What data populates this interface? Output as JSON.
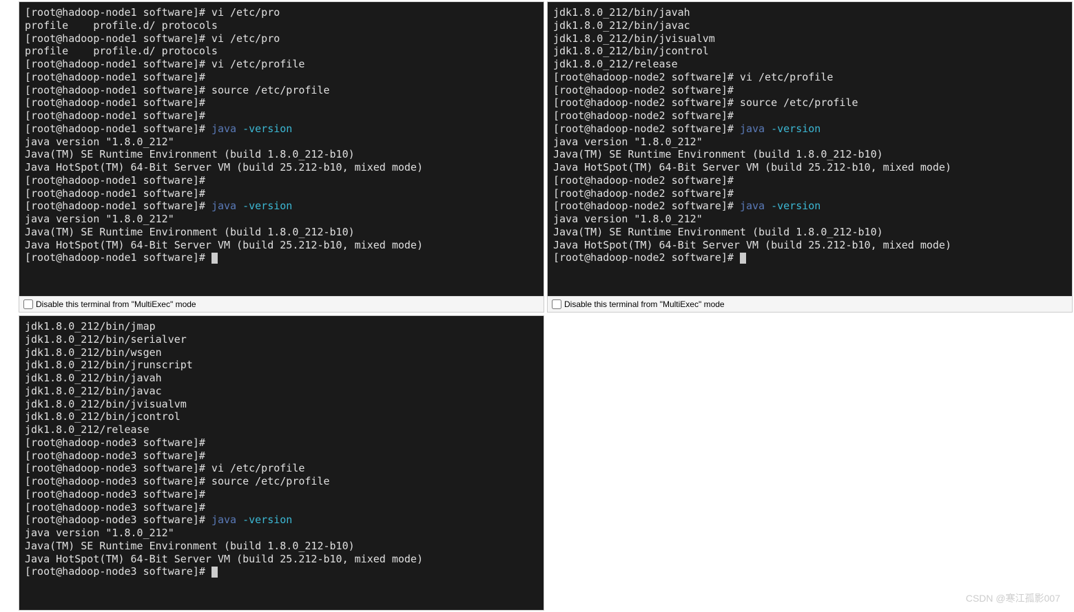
{
  "pane1": {
    "lines": [
      {
        "segments": [
          {
            "t": "[root@hadoop-node1 software]# vi /etc/pro"
          }
        ]
      },
      {
        "segments": [
          {
            "t": "profile    profile.d/ protocols"
          }
        ]
      },
      {
        "segments": [
          {
            "t": "[root@hadoop-node1 software]# vi /etc/pro"
          }
        ]
      },
      {
        "segments": [
          {
            "t": "profile    profile.d/ protocols"
          }
        ]
      },
      {
        "segments": [
          {
            "t": "[root@hadoop-node1 software]# vi /etc/profile"
          }
        ]
      },
      {
        "segments": [
          {
            "t": "[root@hadoop-node1 software]#"
          }
        ]
      },
      {
        "segments": [
          {
            "t": "[root@hadoop-node1 software]# source /etc/profile"
          }
        ]
      },
      {
        "segments": [
          {
            "t": "[root@hadoop-node1 software]#"
          }
        ]
      },
      {
        "segments": [
          {
            "t": "[root@hadoop-node1 software]#"
          }
        ]
      },
      {
        "segments": [
          {
            "t": "[root@hadoop-node1 software]# "
          },
          {
            "t": "java ",
            "cls": "blue"
          },
          {
            "t": "-version",
            "cls": "cyan"
          }
        ]
      },
      {
        "segments": [
          {
            "t": "java version \"1.8.0_212\""
          }
        ]
      },
      {
        "segments": [
          {
            "t": "Java(TM) SE Runtime Environment (build 1.8.0_212-b10)"
          }
        ]
      },
      {
        "segments": [
          {
            "t": "Java HotSpot(TM) 64-Bit Server VM (build 25.212-b10, mixed mode)"
          }
        ]
      },
      {
        "segments": [
          {
            "t": "[root@hadoop-node1 software]#"
          }
        ]
      },
      {
        "segments": [
          {
            "t": "[root@hadoop-node1 software]#"
          }
        ]
      },
      {
        "segments": [
          {
            "t": "[root@hadoop-node1 software]# "
          },
          {
            "t": "java ",
            "cls": "blue"
          },
          {
            "t": "-version",
            "cls": "cyan"
          }
        ]
      },
      {
        "segments": [
          {
            "t": "java version \"1.8.0_212\""
          }
        ]
      },
      {
        "segments": [
          {
            "t": "Java(TM) SE Runtime Environment (build 1.8.0_212-b10)"
          }
        ]
      },
      {
        "segments": [
          {
            "t": "Java HotSpot(TM) 64-Bit Server VM (build 25.212-b10, mixed mode)"
          }
        ]
      },
      {
        "segments": [
          {
            "t": "[root@hadoop-node1 software]# "
          }
        ],
        "cursor": true
      }
    ],
    "footer_label": "Disable this terminal from \"MultiExec\" mode"
  },
  "pane2": {
    "lines": [
      {
        "segments": [
          {
            "t": "jdk1.8.0_212/bin/javah"
          }
        ]
      },
      {
        "segments": [
          {
            "t": "jdk1.8.0_212/bin/javac"
          }
        ]
      },
      {
        "segments": [
          {
            "t": "jdk1.8.0_212/bin/jvisualvm"
          }
        ]
      },
      {
        "segments": [
          {
            "t": "jdk1.8.0_212/bin/jcontrol"
          }
        ]
      },
      {
        "segments": [
          {
            "t": "jdk1.8.0_212/release"
          }
        ]
      },
      {
        "segments": [
          {
            "t": "[root@hadoop-node2 software]# vi /etc/profile"
          }
        ]
      },
      {
        "segments": [
          {
            "t": "[root@hadoop-node2 software]#"
          }
        ]
      },
      {
        "segments": [
          {
            "t": "[root@hadoop-node2 software]# source /etc/profile"
          }
        ]
      },
      {
        "segments": [
          {
            "t": "[root@hadoop-node2 software]#"
          }
        ]
      },
      {
        "segments": [
          {
            "t": "[root@hadoop-node2 software]# "
          },
          {
            "t": "java ",
            "cls": "blue"
          },
          {
            "t": "-version",
            "cls": "cyan"
          }
        ]
      },
      {
        "segments": [
          {
            "t": "java version \"1.8.0_212\""
          }
        ]
      },
      {
        "segments": [
          {
            "t": "Java(TM) SE Runtime Environment (build 1.8.0_212-b10)"
          }
        ]
      },
      {
        "segments": [
          {
            "t": "Java HotSpot(TM) 64-Bit Server VM (build 25.212-b10, mixed mode)"
          }
        ]
      },
      {
        "segments": [
          {
            "t": "[root@hadoop-node2 software]#"
          }
        ]
      },
      {
        "segments": [
          {
            "t": "[root@hadoop-node2 software]#"
          }
        ]
      },
      {
        "segments": [
          {
            "t": "[root@hadoop-node2 software]# "
          },
          {
            "t": "java ",
            "cls": "blue"
          },
          {
            "t": "-version",
            "cls": "cyan"
          }
        ]
      },
      {
        "segments": [
          {
            "t": "java version \"1.8.0_212\""
          }
        ]
      },
      {
        "segments": [
          {
            "t": "Java(TM) SE Runtime Environment (build 1.8.0_212-b10)"
          }
        ]
      },
      {
        "segments": [
          {
            "t": "Java HotSpot(TM) 64-Bit Server VM (build 25.212-b10, mixed mode)"
          }
        ]
      },
      {
        "segments": [
          {
            "t": "[root@hadoop-node2 software]# "
          }
        ],
        "cursor": true
      }
    ],
    "footer_label": "Disable this terminal from \"MultiExec\" mode"
  },
  "pane3": {
    "lines": [
      {
        "segments": [
          {
            "t": "jdk1.8.0_212/bin/jmap"
          }
        ]
      },
      {
        "segments": [
          {
            "t": "jdk1.8.0_212/bin/serialver"
          }
        ]
      },
      {
        "segments": [
          {
            "t": "jdk1.8.0_212/bin/wsgen"
          }
        ]
      },
      {
        "segments": [
          {
            "t": "jdk1.8.0_212/bin/jrunscript"
          }
        ]
      },
      {
        "segments": [
          {
            "t": "jdk1.8.0_212/bin/javah"
          }
        ]
      },
      {
        "segments": [
          {
            "t": "jdk1.8.0_212/bin/javac"
          }
        ]
      },
      {
        "segments": [
          {
            "t": "jdk1.8.0_212/bin/jvisualvm"
          }
        ]
      },
      {
        "segments": [
          {
            "t": "jdk1.8.0_212/bin/jcontrol"
          }
        ]
      },
      {
        "segments": [
          {
            "t": "jdk1.8.0_212/release"
          }
        ]
      },
      {
        "segments": [
          {
            "t": "[root@hadoop-node3 software]#"
          }
        ]
      },
      {
        "segments": [
          {
            "t": "[root@hadoop-node3 software]#"
          }
        ]
      },
      {
        "segments": [
          {
            "t": "[root@hadoop-node3 software]# vi /etc/profile"
          }
        ]
      },
      {
        "segments": [
          {
            "t": "[root@hadoop-node3 software]# source /etc/profile"
          }
        ]
      },
      {
        "segments": [
          {
            "t": "[root@hadoop-node3 software]#"
          }
        ]
      },
      {
        "segments": [
          {
            "t": "[root@hadoop-node3 software]#"
          }
        ]
      },
      {
        "segments": [
          {
            "t": "[root@hadoop-node3 software]# "
          },
          {
            "t": "java ",
            "cls": "blue"
          },
          {
            "t": "-version",
            "cls": "cyan"
          }
        ]
      },
      {
        "segments": [
          {
            "t": "java version \"1.8.0_212\""
          }
        ]
      },
      {
        "segments": [
          {
            "t": "Java(TM) SE Runtime Environment (build 1.8.0_212-b10)"
          }
        ]
      },
      {
        "segments": [
          {
            "t": "Java HotSpot(TM) 64-Bit Server VM (build 25.212-b10, mixed mode)"
          }
        ]
      },
      {
        "segments": [
          {
            "t": "[root@hadoop-node3 software]# "
          }
        ],
        "cursor": true
      }
    ]
  },
  "watermark": "CSDN @寒江孤影007"
}
